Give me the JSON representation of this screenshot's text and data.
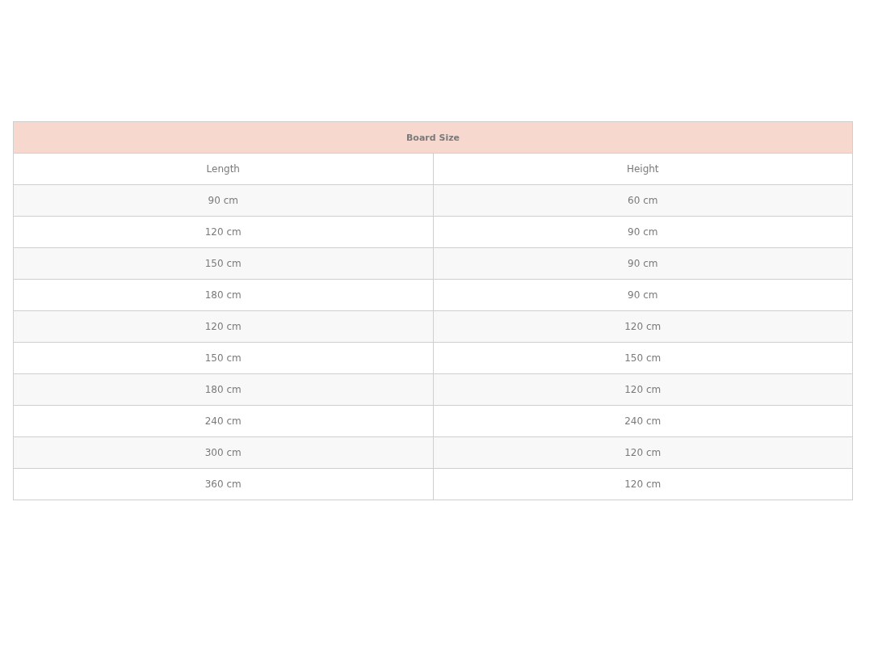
{
  "table": {
    "title": "Board Size",
    "columns": [
      "Length",
      "Height"
    ],
    "rows": [
      [
        "90 cm",
        "60 cm"
      ],
      [
        "120 cm",
        "90 cm"
      ],
      [
        "150 cm",
        "90 cm"
      ],
      [
        "180 cm",
        "90 cm"
      ],
      [
        "120 cm",
        "120 cm"
      ],
      [
        "150 cm",
        "150 cm"
      ],
      [
        "180 cm",
        "120 cm"
      ],
      [
        "240 cm",
        "240 cm"
      ],
      [
        "300 cm",
        "120 cm"
      ],
      [
        "360 cm",
        "120 cm"
      ]
    ]
  }
}
